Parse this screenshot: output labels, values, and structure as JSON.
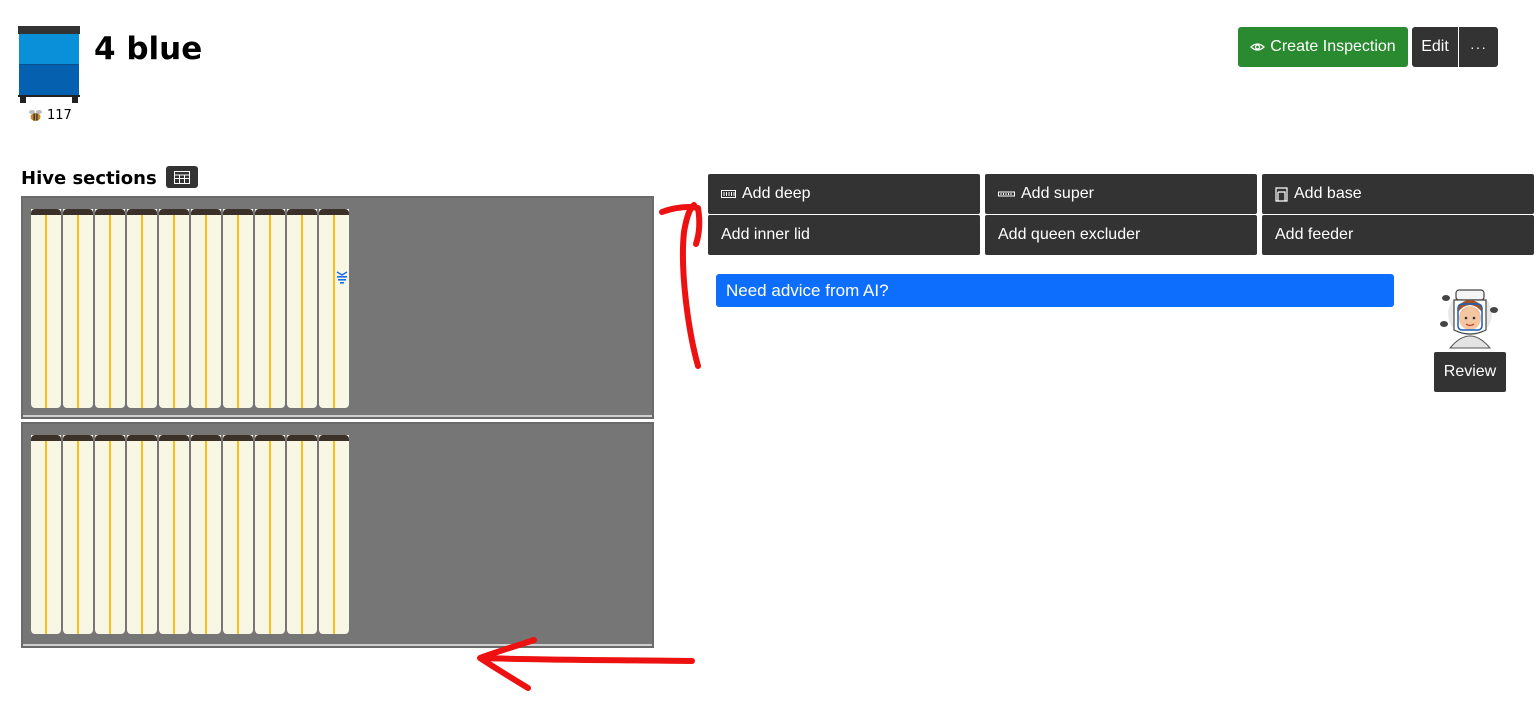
{
  "hive": {
    "title": "4 blue",
    "bee_count": "117",
    "colors": {
      "top_box": "#0a90d8",
      "bottom_box": "#0660b0",
      "lid": "#333333"
    }
  },
  "header": {
    "create_inspection_label": "Create Inspection",
    "edit_label": "Edit",
    "more_label": "···"
  },
  "sections": {
    "label": "Hive sections",
    "table_icon": "table-icon",
    "boxes": [
      {
        "frames": 10,
        "queen_marker": true
      },
      {
        "frames": 10,
        "queen_marker": false
      }
    ]
  },
  "actions": {
    "add_deep": "Add deep",
    "add_super": "Add super",
    "add_base": "Add base",
    "add_inner_lid": "Add inner lid",
    "add_queen_excluder": "Add queen excluder",
    "add_feeder": "Add feeder"
  },
  "ai": {
    "prompt": "Need advice from AI?",
    "review_label": "Review"
  },
  "colors": {
    "green": "#2a8a2f",
    "dark_button": "#333333",
    "ai_blue": "#0d6efd",
    "box_gray": "#767676",
    "annotation_red": "#ee1111"
  }
}
